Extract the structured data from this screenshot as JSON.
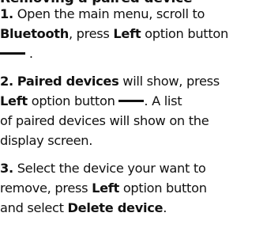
{
  "heading": "Removing a paired device",
  "step1": {
    "number": "1.",
    "text_a": "Open the main menu, scroll to",
    "bluetooth": "Bluetooth",
    "text_b": ", press ",
    "left": "Left",
    "text_c": " option button",
    "end": "."
  },
  "step2": {
    "number": "2.",
    "paired_devices": "Paired devices",
    "text_a": " will show, press",
    "left": "Left",
    "text_b": " option button ",
    "text_c": ". A list",
    "text_d": "of paired devices will show on the",
    "text_e": "display screen."
  },
  "step3": {
    "number": "3.",
    "text_a": "Select the device your want to",
    "text_b": "remove, press ",
    "left": "Left",
    "text_c": " option button",
    "text_d": "and select ",
    "delete_device": "Delete device",
    "end": "."
  }
}
